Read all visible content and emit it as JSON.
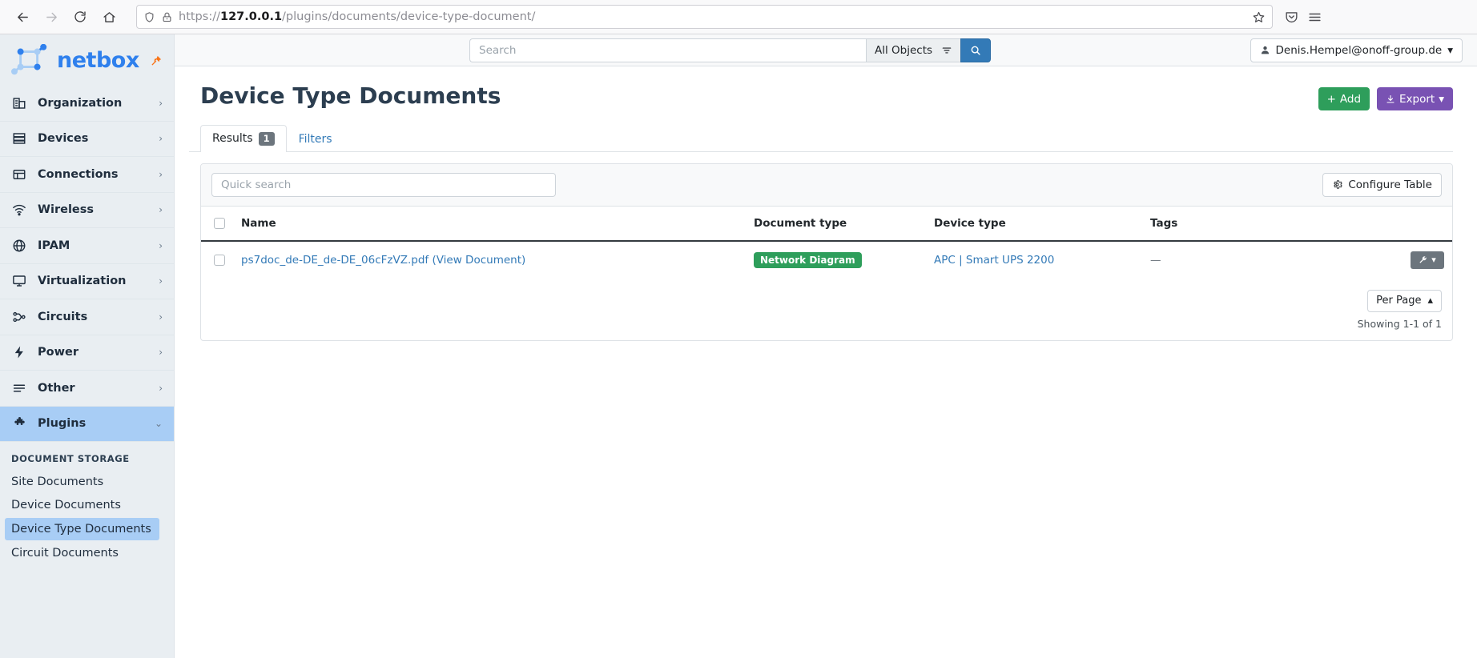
{
  "browser": {
    "back_icon": "arrow-left-icon",
    "forward_icon": "arrow-right-icon",
    "reload_icon": "reload-icon",
    "home_icon": "home-icon",
    "shield_icon": "shield-icon",
    "lock_warning_icon": "lock-warning-icon",
    "url_scheme": "https://",
    "url_host": "127.0.0.1",
    "url_path": "/plugins/documents/device-type-document/",
    "bookmark_icon": "star-icon",
    "pocket_icon": "pocket-icon",
    "menu_icon": "hamburger-menu-icon"
  },
  "sidebar": {
    "brand": "netbox",
    "pin_icon": "pin-icon",
    "items": [
      {
        "label": "Organization",
        "icon": "building-icon"
      },
      {
        "label": "Devices",
        "icon": "server-icon"
      },
      {
        "label": "Connections",
        "icon": "connections-icon"
      },
      {
        "label": "Wireless",
        "icon": "wifi-icon"
      },
      {
        "label": "IPAM",
        "icon": "globe-icon"
      },
      {
        "label": "Virtualization",
        "icon": "monitor-icon"
      },
      {
        "label": "Circuits",
        "icon": "circuits-icon"
      },
      {
        "label": "Power",
        "icon": "bolt-icon"
      },
      {
        "label": "Other",
        "icon": "list-icon"
      },
      {
        "label": "Plugins",
        "icon": "puzzle-icon"
      }
    ],
    "plugins_section": {
      "heading": "DOCUMENT STORAGE",
      "items": [
        {
          "label": "Site Documents"
        },
        {
          "label": "Device Documents"
        },
        {
          "label": "Device Type Documents"
        },
        {
          "label": "Circuit Documents"
        }
      ]
    }
  },
  "topbar": {
    "search_placeholder": "Search",
    "search_value": "",
    "object_scope": "All Objects",
    "filter_icon": "filter-icon",
    "search_button_icon": "search-icon",
    "user_icon": "user-icon",
    "user_name": "Denis.Hempel@onoff-group.de",
    "caret_icon": "caret-down-icon"
  },
  "page": {
    "title": "Device Type Documents",
    "add_label": "Add",
    "add_icon": "plus-icon",
    "export_label": "Export",
    "export_icon": "download-icon"
  },
  "tabs": [
    {
      "label": "Results",
      "badge": "1",
      "active": true
    },
    {
      "label": "Filters",
      "badge": "",
      "active": false
    }
  ],
  "toolbar": {
    "quick_search_placeholder": "Quick search",
    "quick_search_value": "",
    "configure_label": "Configure Table",
    "configure_icon": "gear-icon"
  },
  "table": {
    "columns": [
      "Name",
      "Document type",
      "Device type",
      "Tags"
    ],
    "rows": [
      {
        "name": "ps7doc_de-DE_de-DE_06cFzVZ.pdf",
        "view_link": "View Document",
        "document_type": "Network Diagram",
        "document_type_color": "#2e9e5b",
        "device_type": "APC | Smart UPS 2200",
        "tags": "—",
        "action_icon": "wrench-icon"
      }
    ]
  },
  "footer": {
    "per_page_label": "Per Page",
    "per_page_caret": "caret-up-icon",
    "showing": "Showing 1-1 of 1"
  }
}
